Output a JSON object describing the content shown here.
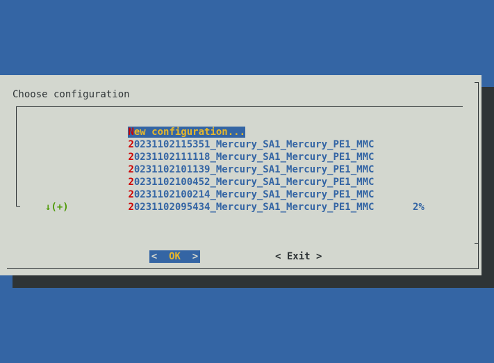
{
  "dialog": {
    "title": "Choose configuration"
  },
  "menu": {
    "items": [
      {
        "first": "N",
        "rest": "ew configuration...",
        "selected": true
      },
      {
        "first": "2",
        "rest": "0231102115351_Mercury_SA1_Mercury_PE1_MMC",
        "selected": false
      },
      {
        "first": "2",
        "rest": "0231102111118_Mercury_SA1_Mercury_PE1_MMC",
        "selected": false
      },
      {
        "first": "2",
        "rest": "0231102101139_Mercury_SA1_Mercury_PE1_MMC",
        "selected": false
      },
      {
        "first": "2",
        "rest": "0231102100452_Mercury_SA1_Mercury_PE1_MMC",
        "selected": false
      },
      {
        "first": "2",
        "rest": "0231102100214_Mercury_SA1_Mercury_PE1_MMC",
        "selected": false
      },
      {
        "first": "2",
        "rest": "0231102095434_Mercury_SA1_Mercury_PE1_MMC",
        "selected": false
      }
    ],
    "more_indicator": "↓(+)",
    "scroll_percent": "2%"
  },
  "buttons": {
    "ok_left": "<",
    "ok_label": "OK",
    "ok_right": ">",
    "exit_label": "< Exit >"
  },
  "colors": {
    "background": "#3465a4",
    "dialog": "#d3d7cf",
    "shadow": "#2e3436",
    "highlight_text": "#e9b82a",
    "hotkey": "#cc0000",
    "scroll_indicator": "#4e9a06"
  }
}
